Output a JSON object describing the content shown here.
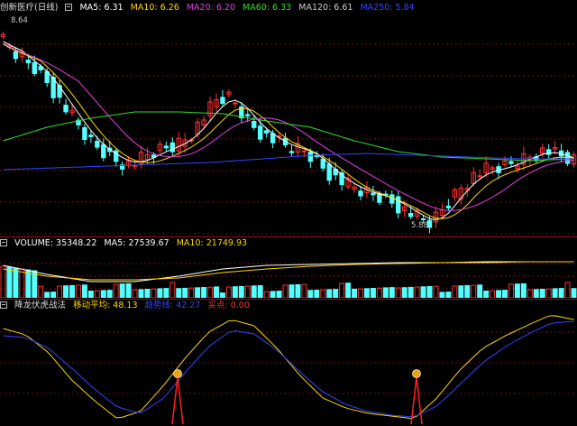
{
  "price_panel": {
    "title": "创新医疗(日线)",
    "ma": [
      {
        "label": "MA5: 6.31",
        "color": "#ffffff"
      },
      {
        "label": "MA10: 6.26",
        "color": "#ffd700"
      },
      {
        "label": "MA20: 6.20",
        "color": "#e040e0"
      },
      {
        "label": "MA60: 6.33",
        "color": "#33dd33"
      },
      {
        "label": "MA120: 6.61",
        "color": "#cccccc"
      },
      {
        "label": "MA250: 5.84",
        "color": "#3344ff"
      }
    ],
    "high_label": "8.64",
    "low_label": "5.88"
  },
  "volume_panel": {
    "title": "VOLUME: 35348.22",
    "ma5": "MA5: 27539.67",
    "ma10": "MA10: 21749.93",
    "title_color": "#ffffff",
    "ma5_color": "#ffffff",
    "ma10_color": "#ffd700"
  },
  "indicator_panel": {
    "name": "降龙伏虎战法",
    "moving_avg": "移动平均: 48.13",
    "trend_line": "趋势线: 42.27",
    "signal": "买点: 0.00",
    "name_color": "#dddddd",
    "moving_avg_color": "#ffd700",
    "trend_line_color": "#3344ff",
    "signal_color": "#ff3030"
  },
  "colors": {
    "up": "#ff3232",
    "down": "#54ffff",
    "grid": "#7a1010",
    "background": "#000000"
  },
  "icons": [
    "window-square-icon",
    "money-bag-icon"
  ]
}
